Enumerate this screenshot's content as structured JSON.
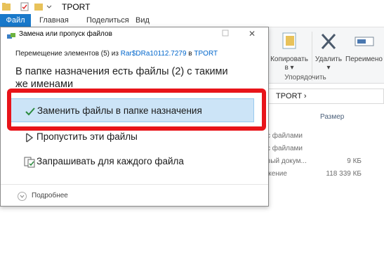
{
  "window": {
    "title": "TPORT"
  },
  "ribbon": {
    "tabs": [
      "Файл",
      "Главная",
      "Поделиться",
      "Вид"
    ],
    "buttons": {
      "copy": "Копировать\nв ▾",
      "delete": "Удалить\n▾",
      "rename": "Переимено"
    },
    "group": "Упорядочить"
  },
  "address": {
    "path": "TPORT ›"
  },
  "columns": {
    "size": "Размер"
  },
  "files": [
    {
      "type": "с файлами",
      "size": ""
    },
    {
      "type": "с файлами",
      "size": ""
    },
    {
      "type": "вый докум...",
      "size": "9 КБ"
    },
    {
      "type": "жение",
      "size": "118 339 КБ"
    }
  ],
  "dialog": {
    "title": "Замена или пропуск файлов",
    "operation": {
      "prefix": "Перемещение элементов (5) из ",
      "source": "Rar$DRa10112.7279",
      "mid": " в ",
      "dest": "TPORT"
    },
    "heading": "В папке назначения есть файлы (2) с такими же именами",
    "options": {
      "replace": "Заменить файлы в папке назначения",
      "skip": "Пропустить эти файлы",
      "ask": "Запрашивать для каждого файла"
    },
    "more": "Подробнее"
  },
  "colors": {
    "highlight": "#e8141a",
    "selected": "#cce4f7",
    "accent": "#1979ca",
    "check": "#2b8a3e"
  }
}
